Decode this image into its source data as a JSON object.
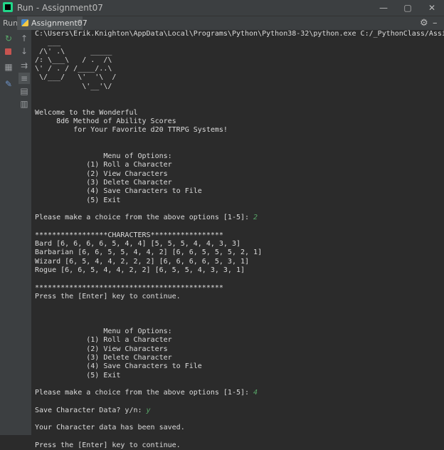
{
  "window": {
    "title": "Run - Assignment07",
    "minimize": "—",
    "restore": "▢",
    "close": "✕"
  },
  "run_panel": {
    "label": "Run:",
    "tab_label": "Assignment07",
    "tab_close": "×",
    "settings_icon": "gear-icon",
    "hide_icon": "minus-icon"
  },
  "toolbar": {
    "buttons": [
      "rerun-icon",
      "stop-icon",
      "up-icon",
      "down-icon",
      "layout-icon",
      "soft-wrap-icon",
      "scroll-to-end-icon",
      "print-icon",
      "pin-icon",
      "trash-icon"
    ]
  },
  "console": {
    "command": "C:\\Users\\Erik.Knighton\\AppData\\Local\\Programs\\Python\\Python38-32\\python.exe C:/_PythonClass/Assignme",
    "art": [
      "   ___",
      " /\\' .\\      _____",
      "/: \\___\\   / .  /\\",
      "\\' / . / /____/..\\",
      " \\/___/   \\'  '\\  /",
      "           \\'__'\\/"
    ],
    "welcome": [
      "Welcome to the Wonderful",
      "     8d6 Method of Ability Scores",
      "         for Your Favorite d20 TTRPG Systems!"
    ],
    "menu_header": "                Menu of Options:",
    "menu_items": [
      "            (1) Roll a Character",
      "            (2) View Characters",
      "            (3) Delete Character",
      "            (4) Save Characters to File",
      "            (5) Exit"
    ],
    "prompt": "Please make a choice from the above options [1-5]: ",
    "choice_1": "2",
    "characters_header": "*****************CHARACTERS*****************",
    "characters": [
      "Bard [6, 6, 6, 6, 5, 4, 4] [5, 5, 5, 4, 4, 3, 3]",
      "Barbarian [6, 6, 5, 5, 4, 4, 2] [6, 6, 5, 5, 5, 2, 1]",
      "Wizard [6, 5, 4, 4, 2, 2, 2] [6, 6, 6, 6, 5, 3, 1]",
      "Rogue [6, 6, 5, 4, 4, 2, 2] [6, 5, 5, 4, 3, 3, 1]"
    ],
    "characters_footer": "********************************************",
    "continue": "Press the [Enter] key to continue.",
    "choice_2": "4",
    "save_prompt": "Save Character Data? y/n: ",
    "save_answer": "y",
    "saved_msg": "Your Character data has been saved.",
    "continue_2": "Press the [Enter] key to continue."
  }
}
